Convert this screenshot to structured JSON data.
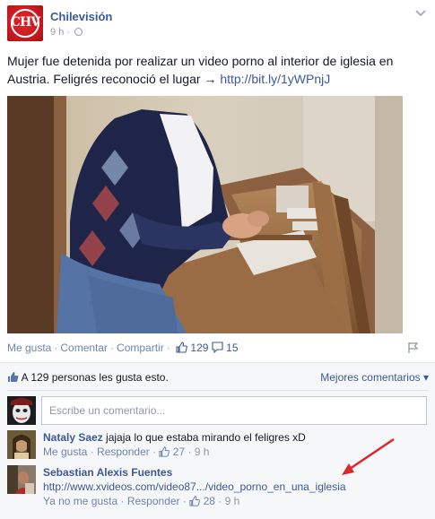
{
  "post": {
    "page_name": "Chilevisión",
    "logo_text": "CHV",
    "time": "9 h",
    "text_line1": "Mujer fue detenida por realizar un video porno al interior de iglesia en",
    "text_line2_pre": "Austria. Feligrés reconoció el lugar → ",
    "link": "http://bit.ly/1yWPnjJ"
  },
  "actions": {
    "like": "Me gusta",
    "comment": "Comentar",
    "share": "Compartir",
    "like_count": "129",
    "comment_count": "15"
  },
  "feedback": {
    "likes_summary": "A 129 personas les gusta esto.",
    "sort_label": "Mejores comentarios",
    "composer_placeholder": "Escribe un comentario..."
  },
  "comments": [
    {
      "author": "Nataly Saez",
      "text": "jajaja lo que estaba mirando el feligres xD",
      "like_label": "Me gusta",
      "reply_label": "Responder",
      "likes": "27",
      "time": "9 h"
    },
    {
      "author": "Sebastian Alexis Fuentes",
      "text": "http://www.xvideos.com/video87.../video_porno_en_una_iglesia",
      "like_label": "Ya no me gusta",
      "reply_label": "Responder",
      "likes": "28",
      "time": "9 h"
    }
  ],
  "colors": {
    "link": "#3b5998",
    "muted": "#9197a3",
    "annotation_arrow": "#e0242a"
  }
}
